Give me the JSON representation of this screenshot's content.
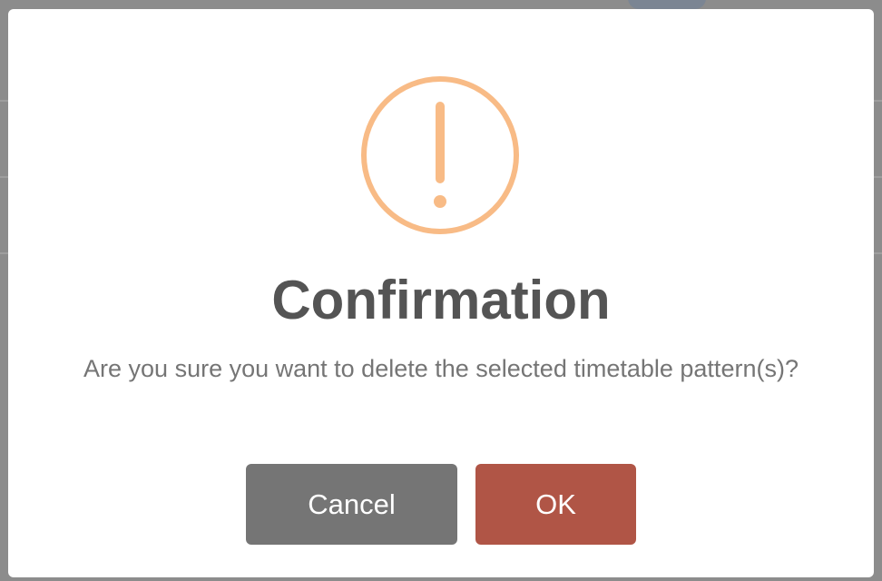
{
  "dialog": {
    "icon": "exclamation-warning-icon",
    "title": "Confirmation",
    "message": "Are you sure you want to delete the selected timetable pattern(s)?",
    "cancel_label": "Cancel",
    "ok_label": "OK"
  },
  "colors": {
    "icon": "#f8bb86",
    "title": "#545454",
    "message": "#757575",
    "cancel_button": "#757575",
    "ok_button": "#b05546",
    "overlay": "#8c8c8c"
  }
}
